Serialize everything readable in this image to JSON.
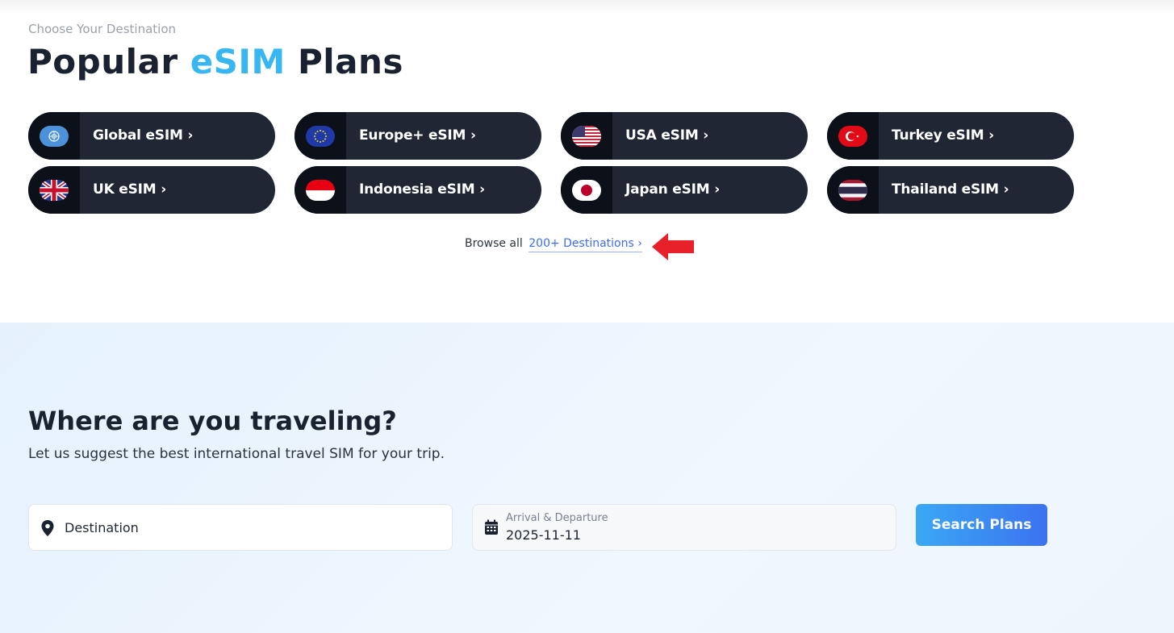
{
  "header": {
    "eyebrow": "Choose Your Destination",
    "title_part1": "Popular",
    "title_accent": "eSIM",
    "title_part2": "Plans"
  },
  "plans": [
    {
      "label": "Global eSIM ›",
      "flag": "un-flag-icon"
    },
    {
      "label": "Europe+ eSIM ›",
      "flag": "eu-flag-icon"
    },
    {
      "label": "USA eSIM ›",
      "flag": "usa-flag-icon"
    },
    {
      "label": "Turkey eSIM ›",
      "flag": "turkey-flag-icon"
    },
    {
      "label": "UK eSIM ›",
      "flag": "uk-flag-icon"
    },
    {
      "label": "Indonesia eSIM ›",
      "flag": "indonesia-flag-icon"
    },
    {
      "label": "Japan eSIM ›",
      "flag": "japan-flag-icon"
    },
    {
      "label": "Thailand eSIM ›",
      "flag": "thailand-flag-icon"
    }
  ],
  "browse": {
    "prefix": "Browse all",
    "link": "200+ Destinations ›"
  },
  "trip": {
    "title": "Where are you traveling?",
    "subtitle": "Let us suggest the best international travel SIM for your trip.",
    "destination_placeholder": "Destination",
    "date_label": "Arrival & Departure",
    "date_value": "2025-11-11",
    "search_button": "Search Plans"
  },
  "colors": {
    "accent": "#38b6f1",
    "pill_bg": "#202634",
    "button_gradient_start": "#3aa8f4",
    "button_gradient_end": "#3c72f0",
    "annotation_arrow": "#e8202a"
  }
}
